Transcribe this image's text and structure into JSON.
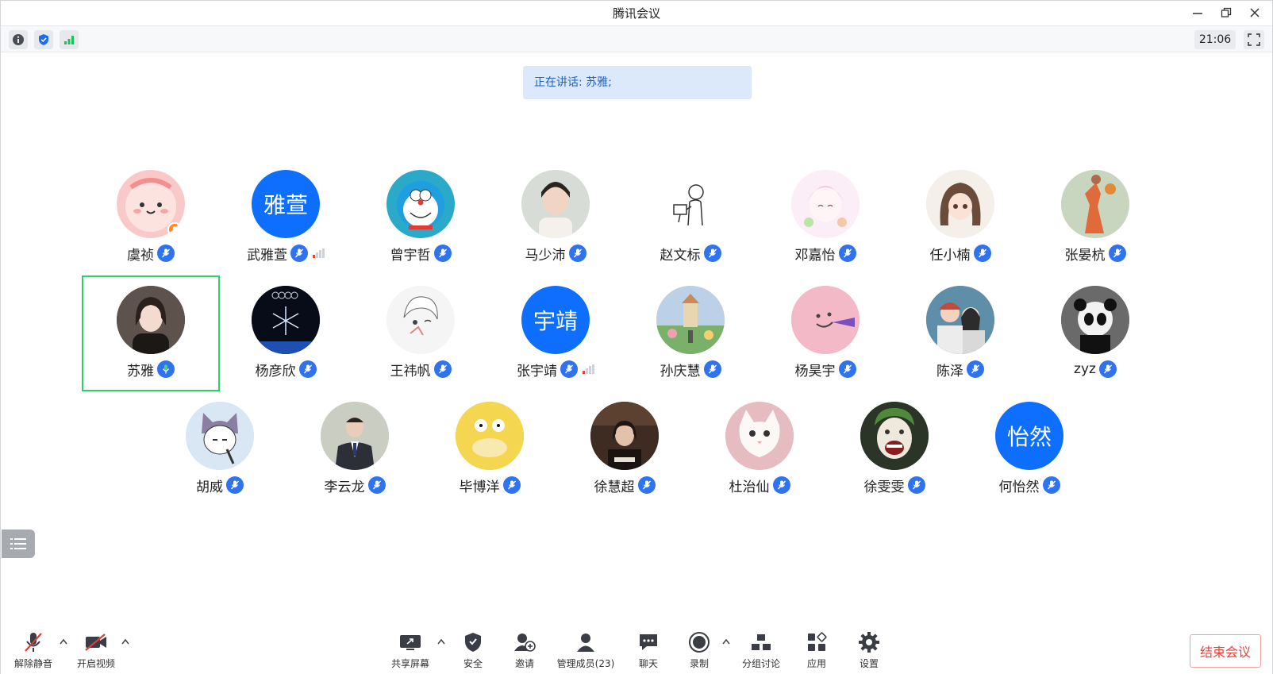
{
  "window": {
    "title": "腾讯会议"
  },
  "infobar": {
    "clock": "21:06"
  },
  "banner": {
    "text": "正在讲话: 苏雅;"
  },
  "participants": {
    "row1": [
      {
        "name": "虞祯",
        "signal": false
      },
      {
        "name": "武雅萱",
        "avatar_text": "雅萱",
        "signal": true
      },
      {
        "name": "曾宇哲",
        "signal": false
      },
      {
        "name": "马少沛",
        "signal": false
      },
      {
        "name": "赵文标",
        "signal": false
      },
      {
        "name": "邓嘉怡",
        "signal": false
      },
      {
        "name": "任小楠",
        "signal": false
      },
      {
        "name": "张晏杭",
        "signal": false
      }
    ],
    "row2": [
      {
        "name": "苏雅",
        "signal": false
      },
      {
        "name": "杨彦欣",
        "signal": false
      },
      {
        "name": "王祎帆",
        "signal": false
      },
      {
        "name": "张宇靖",
        "avatar_text": "宇靖",
        "signal": true
      },
      {
        "name": "孙庆慧",
        "signal": false
      },
      {
        "name": "杨昊宇",
        "signal": false
      },
      {
        "name": "陈泽",
        "signal": false
      },
      {
        "name": "zyz",
        "signal": false
      }
    ],
    "row3": [
      {
        "name": "胡威"
      },
      {
        "name": "李云龙"
      },
      {
        "name": "毕博洋"
      },
      {
        "name": "徐慧超"
      },
      {
        "name": "杜治仙"
      },
      {
        "name": "徐雯雯"
      },
      {
        "name": "何怡然",
        "avatar_text": "怡然"
      }
    ]
  },
  "toolbar": {
    "unmute": "解除静音",
    "start_video": "开启视频",
    "share_screen": "共享屏幕",
    "security": "安全",
    "invite": "邀请",
    "manage_members": "管理成员(23)",
    "chat": "聊天",
    "record": "录制",
    "breakout": "分组讨论",
    "apps": "应用",
    "settings": "设置",
    "end_meeting": "结束会议"
  },
  "colors": {
    "accent": "#2f73f0",
    "speaking_border": "#2fcf6a",
    "end_red": "#e8413a"
  }
}
